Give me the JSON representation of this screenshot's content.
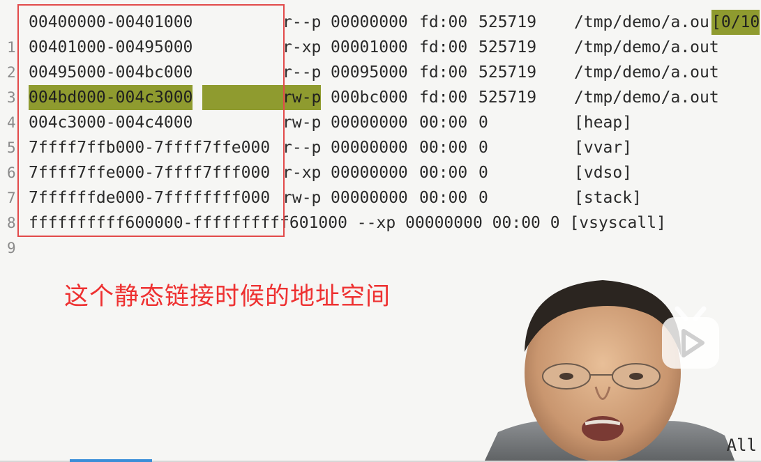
{
  "editor": {
    "lines": [
      {
        "num": "1",
        "range": "00400000-00401000",
        "perm": "r--p",
        "offset": "00000000",
        "dev": "fd:00",
        "inode": "525719",
        "path": "/tmp/demo/a.ou",
        "tail": "[0/10"
      },
      {
        "num": "2",
        "range": "00401000-00495000",
        "perm": "r-xp",
        "offset": "00001000",
        "dev": "fd:00",
        "inode": "525719",
        "path": "/tmp/demo/a.out"
      },
      {
        "num": "3",
        "range": "00495000-004bc000",
        "perm": "r--p",
        "offset": "00095000",
        "dev": "fd:00",
        "inode": "525719",
        "path": "/tmp/demo/a.out"
      },
      {
        "num": "4",
        "range": "004bd000-004c3000",
        "perm": "rw-p",
        "offset": "000bc000",
        "dev": "fd:00",
        "inode": "525719",
        "path": "/tmp/demo/a.out"
      },
      {
        "num": "5",
        "range": "004c3000-004c4000",
        "perm": "rw-p",
        "offset": "00000000",
        "dev": "00:00",
        "inode": "0",
        "path": "[heap]"
      },
      {
        "num": "6",
        "range": "7ffff7ffb000-7ffff7ffe000",
        "perm": "r--p",
        "offset": "00000000",
        "dev": "00:00",
        "inode": "0",
        "path": "[vvar]"
      },
      {
        "num": "7",
        "range": "7ffff7ffe000-7ffff7fff000",
        "perm": "r-xp",
        "offset": "00000000",
        "dev": "00:00",
        "inode": "0",
        "path": "[vdso]"
      },
      {
        "num": "8",
        "range": "7ffffffde000-7ffffffff000",
        "perm": "rw-p",
        "offset": "00000000",
        "dev": "00:00",
        "inode": "0",
        "path": "[stack]"
      },
      {
        "num": "9",
        "full": "ffffffffff600000-ffffffffff601000 --xp 00000000 00:00 0 [vsyscall]"
      }
    ]
  },
  "annotation": {
    "caption": "这个静态链接时候的地址空间"
  },
  "status": {
    "position": "All"
  },
  "colors": {
    "highlight": "#8f9b2f",
    "box": "#e24a4a",
    "caption": "#ee3131"
  },
  "icons": {
    "play": "play-icon"
  }
}
